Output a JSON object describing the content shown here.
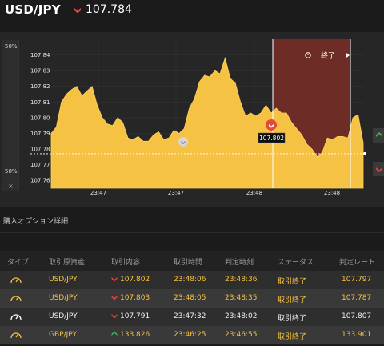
{
  "header": {
    "pair": "USD/JPY",
    "price": "107.784",
    "direction_icon": "down-arrow-red"
  },
  "chart": {
    "y_ticks": [
      "107.84",
      "107.83",
      "107.82",
      "107.81",
      "107.80",
      "107.79",
      "107.78",
      "107.77",
      "107.76"
    ],
    "x_ticks": [
      "23:47",
      "23:47",
      "23:48",
      "23:48"
    ],
    "current_price_label": "107.802",
    "close_label": "終了",
    "meter_top": "50%",
    "meter_bottom": "50%",
    "meter_close": "×",
    "series_color": "#f6c244",
    "expired_zone_color": "#7a2e26"
  },
  "chart_data": {
    "type": "area",
    "title": "",
    "xlabel": "",
    "ylabel": "",
    "ylim": [
      107.755,
      107.85
    ],
    "x_tick_labels": [
      "23:47",
      "23:47",
      "23:48",
      "23:48"
    ],
    "series": [
      {
        "values": [
          107.79,
          107.794,
          107.81,
          107.815,
          107.818,
          107.82,
          107.814,
          107.817,
          107.82,
          107.808,
          107.8,
          107.796,
          107.795,
          107.8,
          107.797,
          107.787,
          107.786,
          107.788,
          107.785,
          107.785,
          107.789,
          107.791,
          107.786,
          107.787,
          107.792,
          107.79,
          107.793,
          107.806,
          107.812,
          107.823,
          107.827,
          107.826,
          107.83,
          107.828,
          107.838,
          107.825,
          107.822,
          107.81,
          107.801,
          107.803,
          107.801,
          107.803,
          107.808,
          107.803,
          107.806,
          107.803,
          107.803,
          107.797,
          107.793,
          107.789,
          107.783,
          107.78,
          107.775,
          107.778,
          107.787,
          107.786,
          107.788,
          107.788,
          107.787,
          107.8,
          107.802,
          107.784
        ]
      }
    ],
    "reference_price": 107.777,
    "grid": true
  },
  "section": {
    "title": "購入オプション詳細"
  },
  "table": {
    "headers": [
      "タイプ",
      "取引原資産",
      "取引内容",
      "取引時間",
      "判定時刻",
      "ステータス",
      "判定レート"
    ],
    "rows": [
      {
        "asset": "USD/JPY",
        "dir": "down",
        "rate": "107.802",
        "time": "23:48:06",
        "judge": "23:48:36",
        "status": "取引終了",
        "final": "107.797",
        "tone": "gold"
      },
      {
        "asset": "USD/JPY",
        "dir": "down",
        "rate": "107.803",
        "time": "23:48:05",
        "judge": "23:48:35",
        "status": "取引終了",
        "final": "107.787",
        "tone": "gold"
      },
      {
        "asset": "USD/JPY",
        "dir": "down",
        "rate": "107.791",
        "time": "23:47:32",
        "judge": "23:48:02",
        "status": "取引終了",
        "final": "107.807",
        "tone": "white"
      },
      {
        "asset": "GBP/JPY",
        "dir": "up",
        "rate": "133.826",
        "time": "23:46:25",
        "judge": "23:46:55",
        "status": "取引終了",
        "final": "133.901",
        "tone": "gold"
      }
    ]
  }
}
